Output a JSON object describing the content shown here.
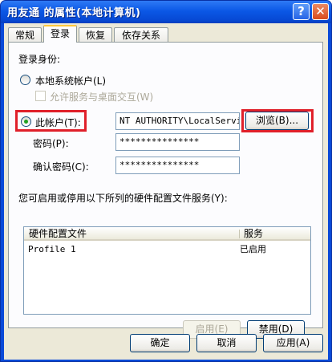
{
  "window": {
    "title": "用友通 的属性(本地计算机)",
    "help_glyph": "?",
    "close_glyph": "✕"
  },
  "tabs": [
    {
      "label": "常规"
    },
    {
      "label": "登录"
    },
    {
      "label": "恢复"
    },
    {
      "label": "依存关系"
    }
  ],
  "login": {
    "logon_as_label": "登录身份:",
    "local_system_label": "本地系统帐户(L)",
    "allow_desktop_label": "允许服务与桌面交互(W)",
    "this_account_label": "此帐户(T):",
    "account_value": "NT AUTHORITY\\LocalService",
    "browse_label": "浏览(B)...",
    "password_label": "密码(P):",
    "password_value": "***************",
    "confirm_label": "确认密码(C):",
    "confirm_value": "***************"
  },
  "hardware": {
    "caption": "您可启用或停用以下所列的硬件配置文件服务(Y):",
    "columns": [
      "硬件配置文件",
      "服务"
    ],
    "rows": [
      {
        "profile": "Profile 1",
        "service": "已启用"
      }
    ],
    "enable_label": "启用(E)",
    "disable_label": "禁用(D)"
  },
  "footer": {
    "ok_label": "确定",
    "cancel_label": "取消",
    "apply_label": "应用(A)"
  },
  "colors": {
    "titlebar": "#0b58e6",
    "dialog_bg": "#ece9d8",
    "highlight_box": "#e0202a",
    "selected_radio": "#21a121"
  }
}
